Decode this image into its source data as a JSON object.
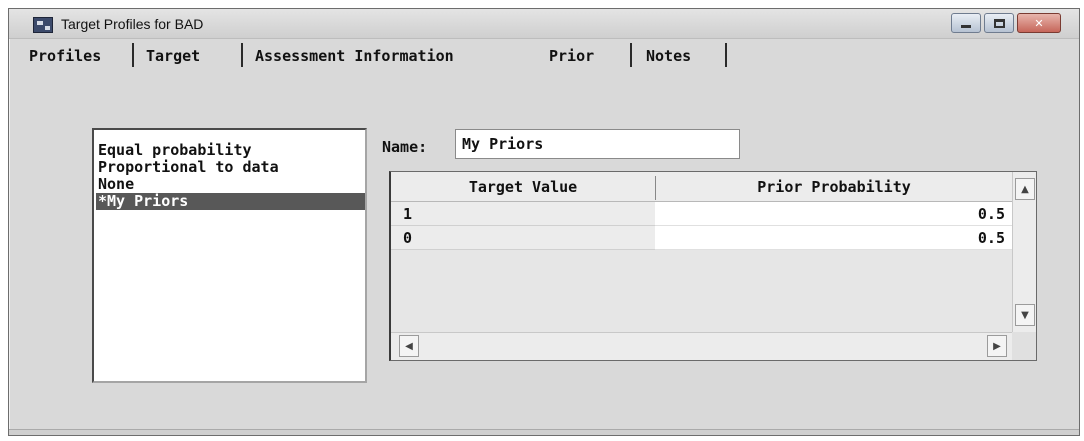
{
  "window": {
    "title": "Target Profiles for BAD"
  },
  "tabs": [
    {
      "label": "Profiles"
    },
    {
      "label": "Target"
    },
    {
      "label": "Assessment Information"
    },
    {
      "label": "Prior"
    },
    {
      "label": "Notes"
    }
  ],
  "prior_list": {
    "items": [
      {
        "label": "Equal probability",
        "selected": false
      },
      {
        "label": "Proportional to data",
        "selected": false
      },
      {
        "label": "None",
        "selected": false
      },
      {
        "label": "*My Priors",
        "selected": true
      }
    ]
  },
  "name_field": {
    "label": "Name:",
    "value": "My Priors"
  },
  "grid": {
    "columns": [
      "Target Value",
      "Prior Probability"
    ],
    "rows": [
      {
        "target_value": "1",
        "prior_probability": "0.5"
      },
      {
        "target_value": "0",
        "prior_probability": "0.5"
      }
    ]
  },
  "icons": {
    "app": "sas-target-icon",
    "minimize": "minimize-icon",
    "maximize": "maximize-icon",
    "close": "close-icon"
  }
}
